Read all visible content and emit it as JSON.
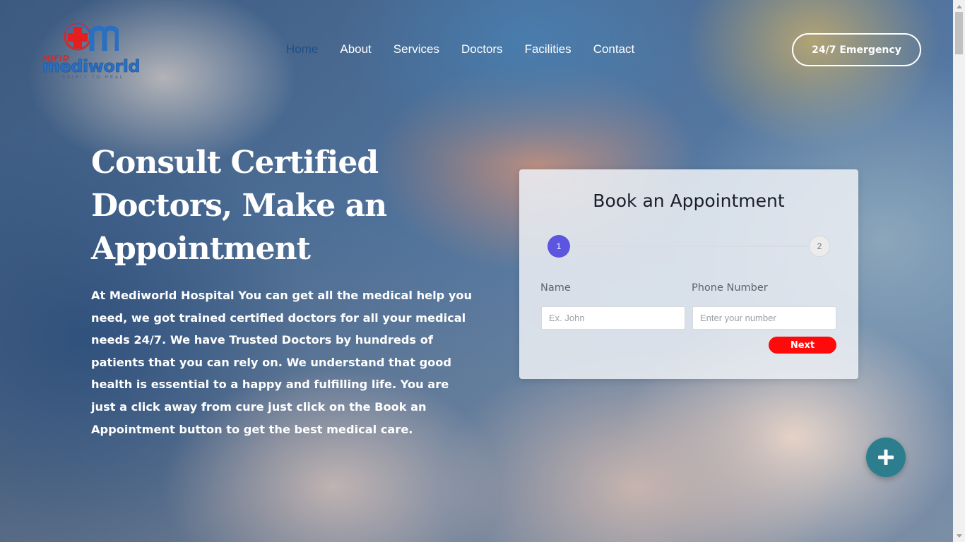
{
  "brand": {
    "small": "MJFID",
    "name": "mediworld",
    "tagline": "SPIRIT TO HEAL",
    "logo_icon": "medical-cross-m-logo"
  },
  "nav": {
    "items": [
      {
        "label": "Home",
        "active": true
      },
      {
        "label": "About"
      },
      {
        "label": "Services"
      },
      {
        "label": "Doctors"
      },
      {
        "label": "Facilities"
      },
      {
        "label": "Contact"
      }
    ],
    "active_color": "#1e4f86"
  },
  "emergency_label": "24/7 Emergency",
  "hero": {
    "title": "Consult Certified Doctors, Make an Appointment",
    "description": "At Mediworld Hospital You can get all the medical help you need, we got trained certified doctors for all your medical needs 24/7. We have Trusted Doctors by hundreds of patients that you can rely on. We understand that good health is essential to a happy and fulfilling life. You are just a click away from cure just click on the Book an Appointment button to get the best medical care."
  },
  "appointment": {
    "title": "Book an Appointment",
    "steps": [
      "1",
      "2"
    ],
    "current_step": 1,
    "name_label": "Name",
    "name_placeholder": "Ex. John",
    "phone_label": "Phone Number",
    "phone_placeholder": "Enter your number",
    "next_label": "Next",
    "accent": "#5b55e0",
    "button_color": "#ff0a0a"
  },
  "fab_icon": "plus-icon",
  "fab_color": "#2c7e8e"
}
